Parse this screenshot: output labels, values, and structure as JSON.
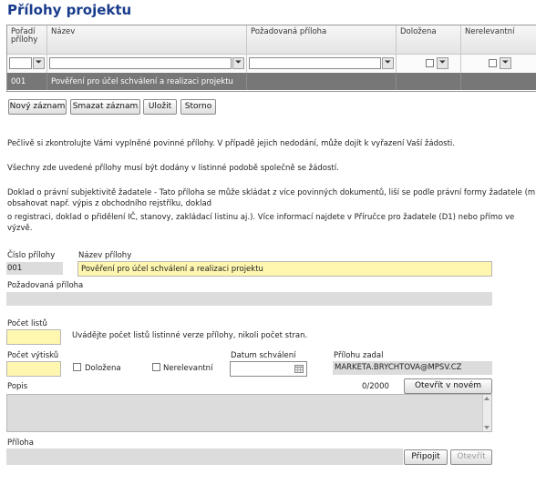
{
  "page_title": "Přílohy projektu",
  "grid": {
    "columns": [
      "Pořadí přílohy",
      "Název",
      "Požadovaná příloha",
      "Doložena",
      "Nerelevantní"
    ],
    "rows": [
      {
        "poradi": "001",
        "nazev": "Pověření pro účel schválení a realizaci projektu",
        "pozadovana": "",
        "dolozena": "",
        "nerelevantni": ""
      }
    ]
  },
  "toolbar": {
    "new_label": "Nový záznam",
    "delete_label": "Smazat záznam",
    "save_label": "Uložit",
    "cancel_label": "Storno"
  },
  "info": {
    "p1": "Pečlivě si zkontrolujte Vámi vyplněné povinné přílohy. V případě jejich nedodání, může dojít k vyřazení Vaší žádosti.",
    "p2": "Všechny zde uvedené přílohy musí být dodány v listinné podobě společně se žádostí.",
    "p3_line1": "Doklad o právní subjektivitě žadatele - Tato příloha se může skládat z více povinných dokumentů, liší se podle právní formy žadatele (může",
    "p3_line2": "obsahovat např. výpis z obchodního rejstříku, doklad",
    "p3_line3": "o registraci, doklad o přidělení IČ, stanovy, zakládací listinu aj.). Více informací najdete v Příručce pro žadatele (D1) nebo přímo ve",
    "p3_line4": "výzvě."
  },
  "form": {
    "cislo_label": "Číslo přílohy",
    "cislo_value": "001",
    "nazev_label": "Název přílohy",
    "nazev_value": "Pověření pro účel schválení a realizaci projektu",
    "pozadovana_label": "Požadovaná příloha",
    "pocet_listu_label": "Počet listů",
    "pocet_listu_hint": "Uvádějte počet listů listinné verze přílohy, nikoli počet stran.",
    "pocet_vytisku_label": "Počet výtisků",
    "dolozena_label": "Doložena",
    "nerelevantni_label": "Nerelevantní",
    "datum_label": "Datum schválení",
    "zadal_label": "Přílohu zadal",
    "zadal_value": "MARKETA.BRYCHTOVA@MPSV.CZ",
    "popis_label": "Popis",
    "popis_counter": "0/2000",
    "open_new_window_label": "Otevřít v novém okně",
    "priloha_label": "Příloha",
    "pripojit_label": "Připojit",
    "otevrit_label": "Otevřít"
  },
  "colors": {
    "title": "#1a3c8c",
    "required_field": "#fff7b0",
    "selected_row": "#777777"
  }
}
